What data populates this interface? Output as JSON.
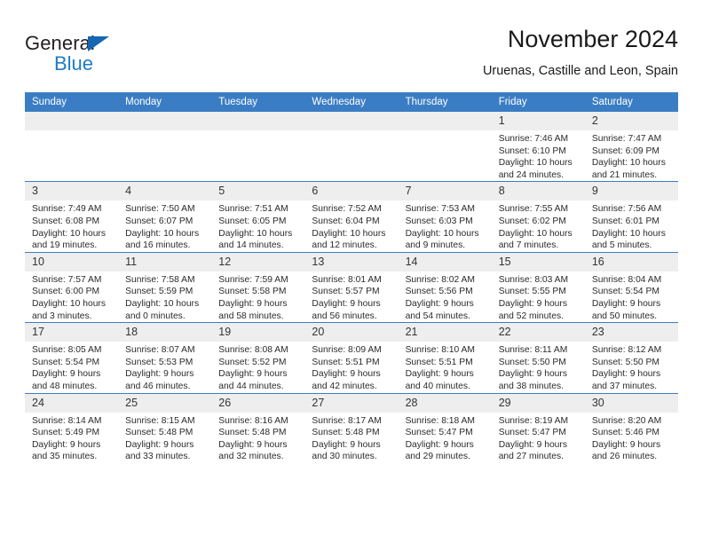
{
  "brand": {
    "name_top": "General",
    "name_bottom": "Blue",
    "triangle_color": "#1567b3",
    "blue_color": "#1f7bc4"
  },
  "header": {
    "title": "November 2024",
    "subtitle": "Uruenas, Castille and Leon, Spain"
  },
  "theme": {
    "header_bg": "#3b7dc4",
    "daynum_bg": "#eeeeee",
    "grid_line": "#3b7dc4"
  },
  "labels": {
    "sunrise_prefix": "Sunrise:",
    "sunset_prefix": "Sunset:",
    "daylight_prefix": "Daylight:"
  },
  "weekdays": [
    "Sunday",
    "Monday",
    "Tuesday",
    "Wednesday",
    "Thursday",
    "Friday",
    "Saturday"
  ],
  "weeks": [
    [
      {
        "day": "",
        "empty": true
      },
      {
        "day": "",
        "empty": true
      },
      {
        "day": "",
        "empty": true
      },
      {
        "day": "",
        "empty": true
      },
      {
        "day": "",
        "empty": true
      },
      {
        "day": "1",
        "sunrise": "Sunrise: 7:46 AM",
        "sunset": "Sunset: 6:10 PM",
        "daylight_line1": "Daylight: 10 hours",
        "daylight_line2": "and 24 minutes."
      },
      {
        "day": "2",
        "sunrise": "Sunrise: 7:47 AM",
        "sunset": "Sunset: 6:09 PM",
        "daylight_line1": "Daylight: 10 hours",
        "daylight_line2": "and 21 minutes."
      }
    ],
    [
      {
        "day": "3",
        "sunrise": "Sunrise: 7:49 AM",
        "sunset": "Sunset: 6:08 PM",
        "daylight_line1": "Daylight: 10 hours",
        "daylight_line2": "and 19 minutes."
      },
      {
        "day": "4",
        "sunrise": "Sunrise: 7:50 AM",
        "sunset": "Sunset: 6:07 PM",
        "daylight_line1": "Daylight: 10 hours",
        "daylight_line2": "and 16 minutes."
      },
      {
        "day": "5",
        "sunrise": "Sunrise: 7:51 AM",
        "sunset": "Sunset: 6:05 PM",
        "daylight_line1": "Daylight: 10 hours",
        "daylight_line2": "and 14 minutes."
      },
      {
        "day": "6",
        "sunrise": "Sunrise: 7:52 AM",
        "sunset": "Sunset: 6:04 PM",
        "daylight_line1": "Daylight: 10 hours",
        "daylight_line2": "and 12 minutes."
      },
      {
        "day": "7",
        "sunrise": "Sunrise: 7:53 AM",
        "sunset": "Sunset: 6:03 PM",
        "daylight_line1": "Daylight: 10 hours",
        "daylight_line2": "and 9 minutes."
      },
      {
        "day": "8",
        "sunrise": "Sunrise: 7:55 AM",
        "sunset": "Sunset: 6:02 PM",
        "daylight_line1": "Daylight: 10 hours",
        "daylight_line2": "and 7 minutes."
      },
      {
        "day": "9",
        "sunrise": "Sunrise: 7:56 AM",
        "sunset": "Sunset: 6:01 PM",
        "daylight_line1": "Daylight: 10 hours",
        "daylight_line2": "and 5 minutes."
      }
    ],
    [
      {
        "day": "10",
        "sunrise": "Sunrise: 7:57 AM",
        "sunset": "Sunset: 6:00 PM",
        "daylight_line1": "Daylight: 10 hours",
        "daylight_line2": "and 3 minutes."
      },
      {
        "day": "11",
        "sunrise": "Sunrise: 7:58 AM",
        "sunset": "Sunset: 5:59 PM",
        "daylight_line1": "Daylight: 10 hours",
        "daylight_line2": "and 0 minutes."
      },
      {
        "day": "12",
        "sunrise": "Sunrise: 7:59 AM",
        "sunset": "Sunset: 5:58 PM",
        "daylight_line1": "Daylight: 9 hours",
        "daylight_line2": "and 58 minutes."
      },
      {
        "day": "13",
        "sunrise": "Sunrise: 8:01 AM",
        "sunset": "Sunset: 5:57 PM",
        "daylight_line1": "Daylight: 9 hours",
        "daylight_line2": "and 56 minutes."
      },
      {
        "day": "14",
        "sunrise": "Sunrise: 8:02 AM",
        "sunset": "Sunset: 5:56 PM",
        "daylight_line1": "Daylight: 9 hours",
        "daylight_line2": "and 54 minutes."
      },
      {
        "day": "15",
        "sunrise": "Sunrise: 8:03 AM",
        "sunset": "Sunset: 5:55 PM",
        "daylight_line1": "Daylight: 9 hours",
        "daylight_line2": "and 52 minutes."
      },
      {
        "day": "16",
        "sunrise": "Sunrise: 8:04 AM",
        "sunset": "Sunset: 5:54 PM",
        "daylight_line1": "Daylight: 9 hours",
        "daylight_line2": "and 50 minutes."
      }
    ],
    [
      {
        "day": "17",
        "sunrise": "Sunrise: 8:05 AM",
        "sunset": "Sunset: 5:54 PM",
        "daylight_line1": "Daylight: 9 hours",
        "daylight_line2": "and 48 minutes."
      },
      {
        "day": "18",
        "sunrise": "Sunrise: 8:07 AM",
        "sunset": "Sunset: 5:53 PM",
        "daylight_line1": "Daylight: 9 hours",
        "daylight_line2": "and 46 minutes."
      },
      {
        "day": "19",
        "sunrise": "Sunrise: 8:08 AM",
        "sunset": "Sunset: 5:52 PM",
        "daylight_line1": "Daylight: 9 hours",
        "daylight_line2": "and 44 minutes."
      },
      {
        "day": "20",
        "sunrise": "Sunrise: 8:09 AM",
        "sunset": "Sunset: 5:51 PM",
        "daylight_line1": "Daylight: 9 hours",
        "daylight_line2": "and 42 minutes."
      },
      {
        "day": "21",
        "sunrise": "Sunrise: 8:10 AM",
        "sunset": "Sunset: 5:51 PM",
        "daylight_line1": "Daylight: 9 hours",
        "daylight_line2": "and 40 minutes."
      },
      {
        "day": "22",
        "sunrise": "Sunrise: 8:11 AM",
        "sunset": "Sunset: 5:50 PM",
        "daylight_line1": "Daylight: 9 hours",
        "daylight_line2": "and 38 minutes."
      },
      {
        "day": "23",
        "sunrise": "Sunrise: 8:12 AM",
        "sunset": "Sunset: 5:50 PM",
        "daylight_line1": "Daylight: 9 hours",
        "daylight_line2": "and 37 minutes."
      }
    ],
    [
      {
        "day": "24",
        "sunrise": "Sunrise: 8:14 AM",
        "sunset": "Sunset: 5:49 PM",
        "daylight_line1": "Daylight: 9 hours",
        "daylight_line2": "and 35 minutes."
      },
      {
        "day": "25",
        "sunrise": "Sunrise: 8:15 AM",
        "sunset": "Sunset: 5:48 PM",
        "daylight_line1": "Daylight: 9 hours",
        "daylight_line2": "and 33 minutes."
      },
      {
        "day": "26",
        "sunrise": "Sunrise: 8:16 AM",
        "sunset": "Sunset: 5:48 PM",
        "daylight_line1": "Daylight: 9 hours",
        "daylight_line2": "and 32 minutes."
      },
      {
        "day": "27",
        "sunrise": "Sunrise: 8:17 AM",
        "sunset": "Sunset: 5:48 PM",
        "daylight_line1": "Daylight: 9 hours",
        "daylight_line2": "and 30 minutes."
      },
      {
        "day": "28",
        "sunrise": "Sunrise: 8:18 AM",
        "sunset": "Sunset: 5:47 PM",
        "daylight_line1": "Daylight: 9 hours",
        "daylight_line2": "and 29 minutes."
      },
      {
        "day": "29",
        "sunrise": "Sunrise: 8:19 AM",
        "sunset": "Sunset: 5:47 PM",
        "daylight_line1": "Daylight: 9 hours",
        "daylight_line2": "and 27 minutes."
      },
      {
        "day": "30",
        "sunrise": "Sunrise: 8:20 AM",
        "sunset": "Sunset: 5:46 PM",
        "daylight_line1": "Daylight: 9 hours",
        "daylight_line2": "and 26 minutes."
      }
    ]
  ]
}
